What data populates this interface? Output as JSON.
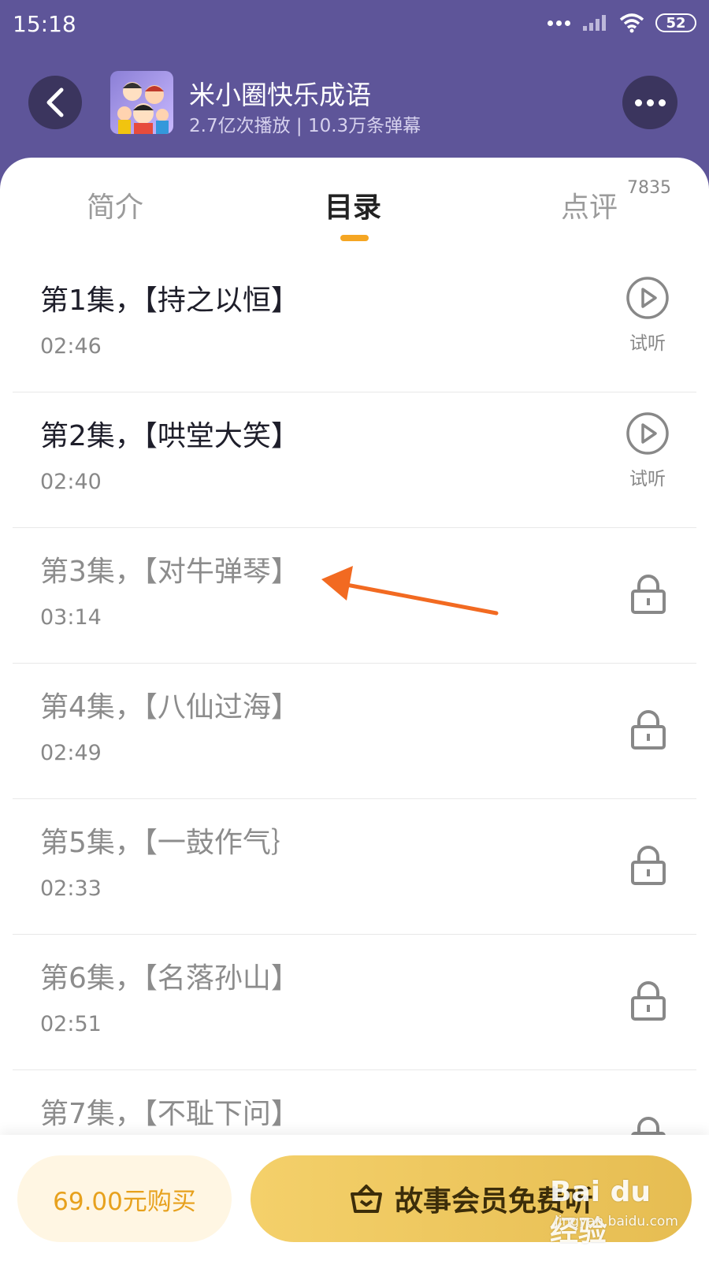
{
  "status_bar": {
    "time": "15:18",
    "battery": "52"
  },
  "header": {
    "title": "米小圈快乐成语",
    "subtitle": "2.7亿次播放 | 10.3万条弹幕"
  },
  "tabs": [
    {
      "label": "简介"
    },
    {
      "label": "目录",
      "active": true
    },
    {
      "label": "点评",
      "count": "7835"
    }
  ],
  "episodes": [
    {
      "title": "第1集，【持之以恒】",
      "duration": "02:46",
      "trial_label": "试听",
      "locked": false
    },
    {
      "title": "第2集，【哄堂大笑】",
      "duration": "02:40",
      "trial_label": "试听",
      "locked": false
    },
    {
      "title": "第3集，【对牛弹琴】",
      "duration": "03:14",
      "locked": true
    },
    {
      "title": "第4集，【八仙过海】",
      "duration": "02:49",
      "locked": true
    },
    {
      "title": "第5集，【一鼓作气｝",
      "duration": "02:33",
      "locked": true
    },
    {
      "title": "第6集，【名落孙山】",
      "duration": "02:51",
      "locked": true
    },
    {
      "title": "第7集，【不耻下问】",
      "duration": "",
      "locked": true
    }
  ],
  "bottom": {
    "buy_label": "69.00元购买",
    "vip_label": "故事会员免费听"
  },
  "watermark": {
    "logo": "Bai du 经验",
    "url": "jingyan.baidu.com"
  },
  "colors": {
    "header_bg": "#5e5599",
    "accent": "#f5a623",
    "annotation_arrow": "#f26a21"
  }
}
